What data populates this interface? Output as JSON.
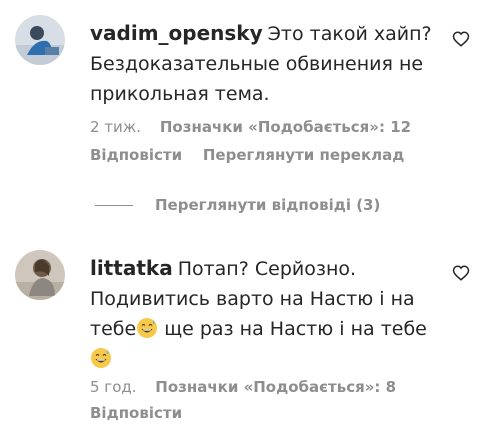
{
  "comments": [
    {
      "username": "vadim_opensky",
      "text": "Это такой хайп? Бездоказательные обвинения не прикольная тема.",
      "time": "2 тиж.",
      "likes": "Позначки «Подобається»: 12",
      "reply": "Відповісти",
      "translate": "Переглянути переклад",
      "view_replies": "Переглянути відповіді (3)"
    },
    {
      "username": "littatka",
      "text_part1": "Потап? Серйозно. Подивитись варто на Настю і на тебе",
      "text_part2": " ще раз на Настю і на тебе",
      "time": "5 год.",
      "likes": "Позначки «Подобається»: 8",
      "reply": "Відповісти"
    }
  ],
  "icons": {
    "like": "heart-outline-icon",
    "emoji": "grinning-sweat-emoji"
  },
  "colors": {
    "text": "#262626",
    "muted": "#8e8e8e",
    "emoji_face": "#f7c948"
  }
}
